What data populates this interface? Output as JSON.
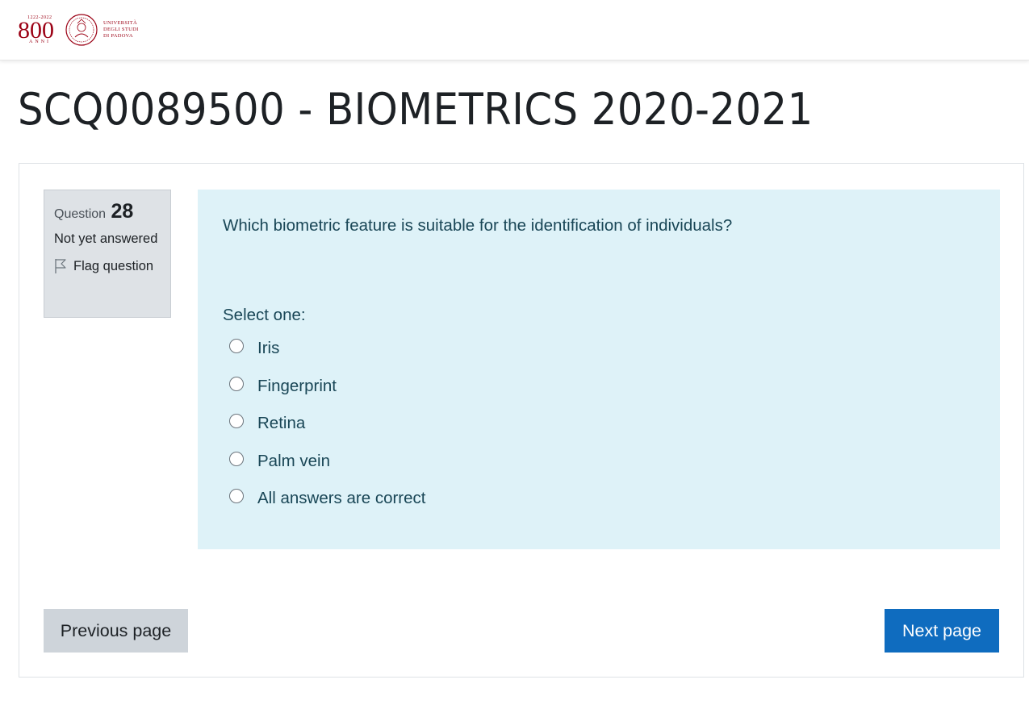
{
  "header": {
    "logo": {
      "anniversary_text": "800",
      "anniversary_years": "1222-2022",
      "anni_text": "ANNI",
      "university_lines": [
        "Università",
        "degli Studi",
        "di Padova"
      ]
    }
  },
  "page": {
    "title": "SCQ0089500 - BIOMETRICS 2020-2021"
  },
  "question_info": {
    "label": "Question",
    "number": "28",
    "state": "Not yet answered",
    "flag_label": "Flag question",
    "flag_icon": "flag-outline-icon"
  },
  "question": {
    "text": "Which biometric feature is suitable for the identification of individuals?",
    "prompt": "Select one:",
    "answers": [
      {
        "label": "Iris",
        "selected": false
      },
      {
        "label": "Fingerprint",
        "selected": false
      },
      {
        "label": "Retina",
        "selected": false
      },
      {
        "label": "Palm vein",
        "selected": false
      },
      {
        "label": "All answers are correct",
        "selected": false
      }
    ]
  },
  "navigation": {
    "prev_label": "Previous page",
    "next_label": "Next page"
  },
  "colors": {
    "brand_red": "#9b0014",
    "primary_blue": "#0f6cbf",
    "question_bg": "#def2f8",
    "question_text": "#194656",
    "info_bg": "#dee2e6"
  }
}
